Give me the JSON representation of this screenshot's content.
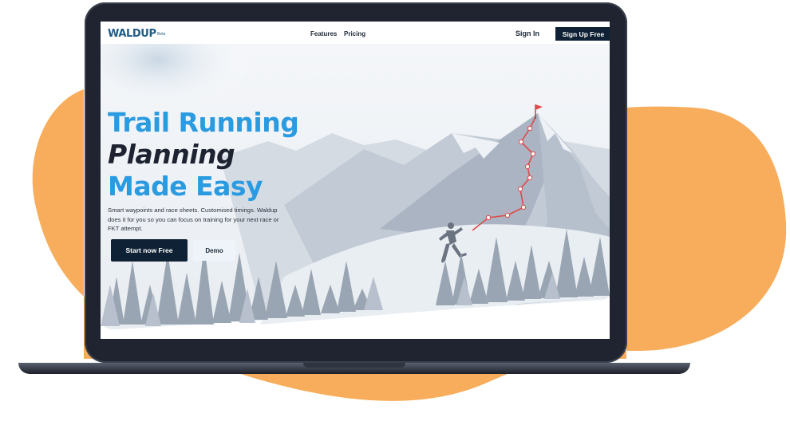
{
  "colors": {
    "accent_orange": "#f7ad5b",
    "brand_blue": "#2a9be0",
    "navy": "#0f2235",
    "route_red": "#e04a4a"
  },
  "nav": {
    "logo": "WALDUP",
    "beta": "Beta",
    "links": [
      "Features",
      "Pricing"
    ],
    "sign_in": "Sign In",
    "sign_up": "Sign Up Free"
  },
  "hero": {
    "line1": "Trail Running",
    "line2": "Planning",
    "line3": "Made Easy",
    "description": "Smart waypoints and race sheets. Customised timings. Waldup does it for you so you can focus on training for your next race or FKT attempt.",
    "cta_primary": "Start now Free",
    "cta_secondary": "Demo"
  },
  "icons": {
    "flag": "summit-flag-icon",
    "runner": "runner-icon"
  }
}
